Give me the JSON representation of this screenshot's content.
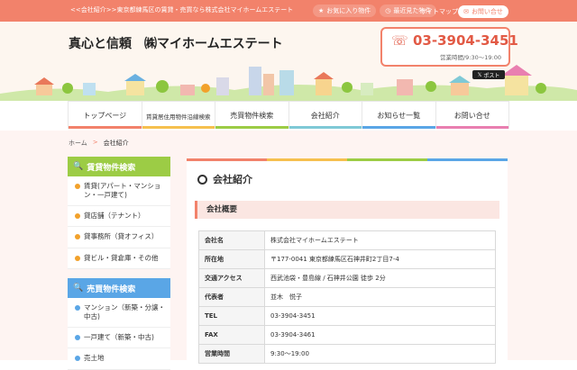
{
  "topbar": {
    "tagline": "<<会社紹介>>東京都練馬区の賃貸・売買なら株式会社マイホームエステート",
    "favorites": "お気に入り物件",
    "recent": "最近見た物件",
    "sitemap": "サイトマップ",
    "contact": "お問い合せ"
  },
  "header": {
    "logo": "真心と信頼　㈱マイホームエステート",
    "phone": "03-3904-3451",
    "hours": "営業時間/9:30〜19:00",
    "social": "ポスト"
  },
  "nav": [
    {
      "label": "トップページ",
      "color": "#f2826b"
    },
    {
      "label": "賃貸居住用物件沿線検索",
      "color": "#f6c04f"
    },
    {
      "label": "売買物件検索",
      "color": "#9ccc45"
    },
    {
      "label": "会社紹介",
      "color": "#7fc9d6"
    },
    {
      "label": "お知らせ一覧",
      "color": "#5aa6e6"
    },
    {
      "label": "お問い合せ",
      "color": "#e97fb0"
    }
  ],
  "breadcrumb": {
    "home": "ホーム",
    "sep": ">",
    "current": "会社紹介"
  },
  "sidebar": {
    "rental_title": "賃貸物件検索",
    "rental_items": [
      "賃貸(アパート・マンション・一戸建て)",
      "貸店舗（テナント）",
      "貸事務所（貸オフィス）",
      "貸ビル・貸倉庫・その他"
    ],
    "sale_title": "売買物件検索",
    "sale_items": [
      "マンション（新築・分譲・中古)",
      "一戸建て（新築・中古)",
      "売土地"
    ]
  },
  "main": {
    "title": "会社紹介",
    "section": "会社概要",
    "rows": [
      {
        "k": "会社名",
        "v": "株式会社マイホームエステート"
      },
      {
        "k": "所在地",
        "v": "〒177-0041 東京都練馬区石神井町2丁目7-4"
      },
      {
        "k": "交通アクセス",
        "v": "西武池袋・豊島線 / 石神井公園 徒歩 2分"
      },
      {
        "k": "代表者",
        "v": "並木　悦子"
      },
      {
        "k": "TEL",
        "v": "03-3904-3451"
      },
      {
        "k": "FAX",
        "v": "03-3904-3461"
      },
      {
        "k": "営業時間",
        "v": "9:30〜19:00"
      }
    ]
  },
  "colors": {
    "accent": "#f2826b",
    "green": "#9ccc45",
    "blue": "#5aa6e6"
  }
}
